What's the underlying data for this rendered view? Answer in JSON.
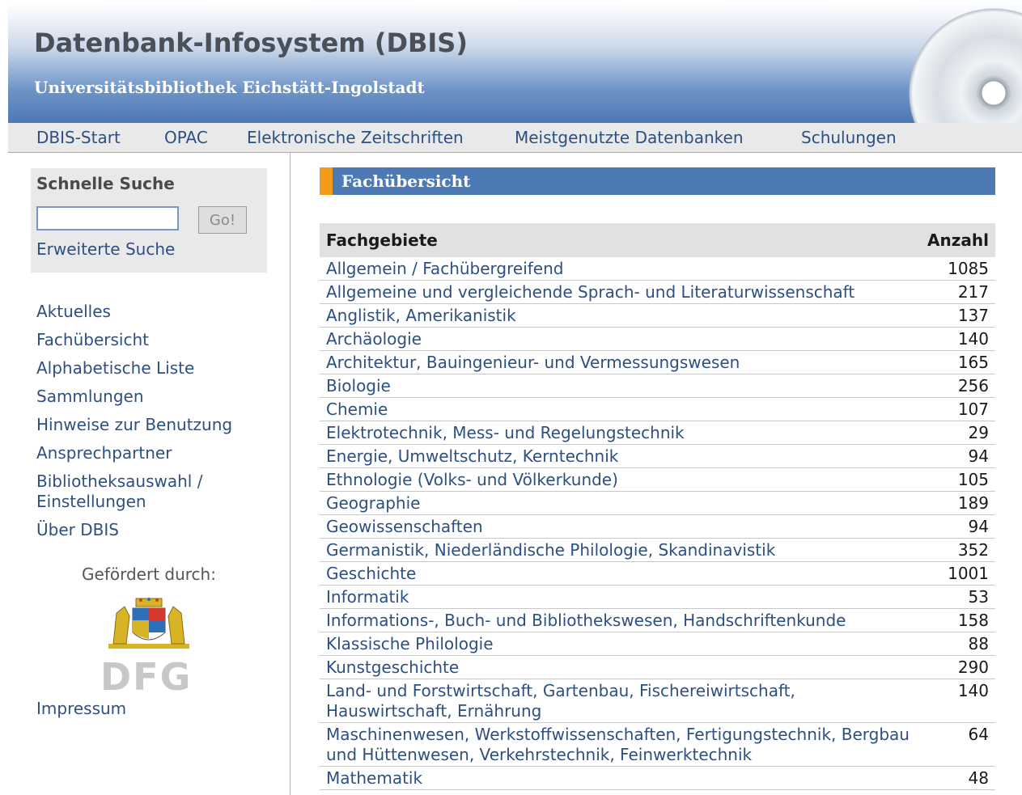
{
  "header": {
    "title": "Datenbank-Infosystem (DBIS)",
    "subtitle": "Universitätsbibliothek Eichstätt-Ingolstadt",
    "cd_icon": "cd-disc-icon"
  },
  "nav": {
    "items": [
      "DBIS-Start",
      "OPAC",
      "Elektronische Zeitschriften",
      "Meistgenutzte Datenbanken",
      "Schulungen"
    ]
  },
  "search": {
    "heading": "Schnelle Suche",
    "input_value": "",
    "go_label": "Go!",
    "advanced_label": "Erweiterte Suche"
  },
  "sidebar": {
    "items": [
      "Aktuelles",
      "Fachübersicht",
      "Alphabetische Liste",
      "Sammlungen",
      "Hinweise zur Benutzung",
      "Ansprechpartner",
      "Bibliotheksauswahl / Einstellungen",
      "Über DBIS"
    ],
    "funded_by": "Gefördert durch:",
    "bavaria_logo": "bavarian-coat-of-arms-icon",
    "dfg_logo_text": "DFG",
    "impressum": "Impressum"
  },
  "main": {
    "section_title": "Fachübersicht",
    "table": {
      "col_subject": "Fachgebiete",
      "col_count": "Anzahl",
      "rows": [
        {
          "name": "Allgemein / Fachübergreifend",
          "count": "1085"
        },
        {
          "name": "Allgemeine und vergleichende Sprach- und Literaturwissenschaft",
          "count": "217"
        },
        {
          "name": "Anglistik, Amerikanistik",
          "count": "137"
        },
        {
          "name": "Archäologie",
          "count": "140"
        },
        {
          "name": "Architektur, Bauingenieur- und Vermessungswesen",
          "count": "165"
        },
        {
          "name": "Biologie",
          "count": "256"
        },
        {
          "name": "Chemie",
          "count": "107"
        },
        {
          "name": "Elektrotechnik, Mess- und Regelungstechnik",
          "count": "29"
        },
        {
          "name": "Energie, Umweltschutz, Kerntechnik",
          "count": "94"
        },
        {
          "name": "Ethnologie (Volks- und Völkerkunde)",
          "count": "105"
        },
        {
          "name": "Geographie",
          "count": "189"
        },
        {
          "name": "Geowissenschaften",
          "count": "94"
        },
        {
          "name": "Germanistik, Niederländische Philologie, Skandinavistik",
          "count": "352"
        },
        {
          "name": "Geschichte",
          "count": "1001"
        },
        {
          "name": "Informatik",
          "count": "53"
        },
        {
          "name": "Informations-, Buch- und Bibliothekswesen, Handschriftenkunde",
          "count": "158"
        },
        {
          "name": "Klassische Philologie",
          "count": "88"
        },
        {
          "name": "Kunstgeschichte",
          "count": "290"
        },
        {
          "name": "Land- und Forstwirtschaft, Gartenbau, Fischereiwirtschaft, Hauswirtschaft, Ernährung",
          "count": "140"
        },
        {
          "name": "Maschinenwesen, Werkstoffwissenschaften, Fertigungstechnik, Bergbau und Hüttenwesen, Verkehrstechnik, Feinwerktechnik",
          "count": "64"
        },
        {
          "name": "Mathematik",
          "count": "48"
        }
      ]
    }
  },
  "colors": {
    "link": "#2d4f82",
    "header_blue": "#4c78b4",
    "section_bar": "#4d7ab5",
    "section_accent": "#f39a18"
  }
}
